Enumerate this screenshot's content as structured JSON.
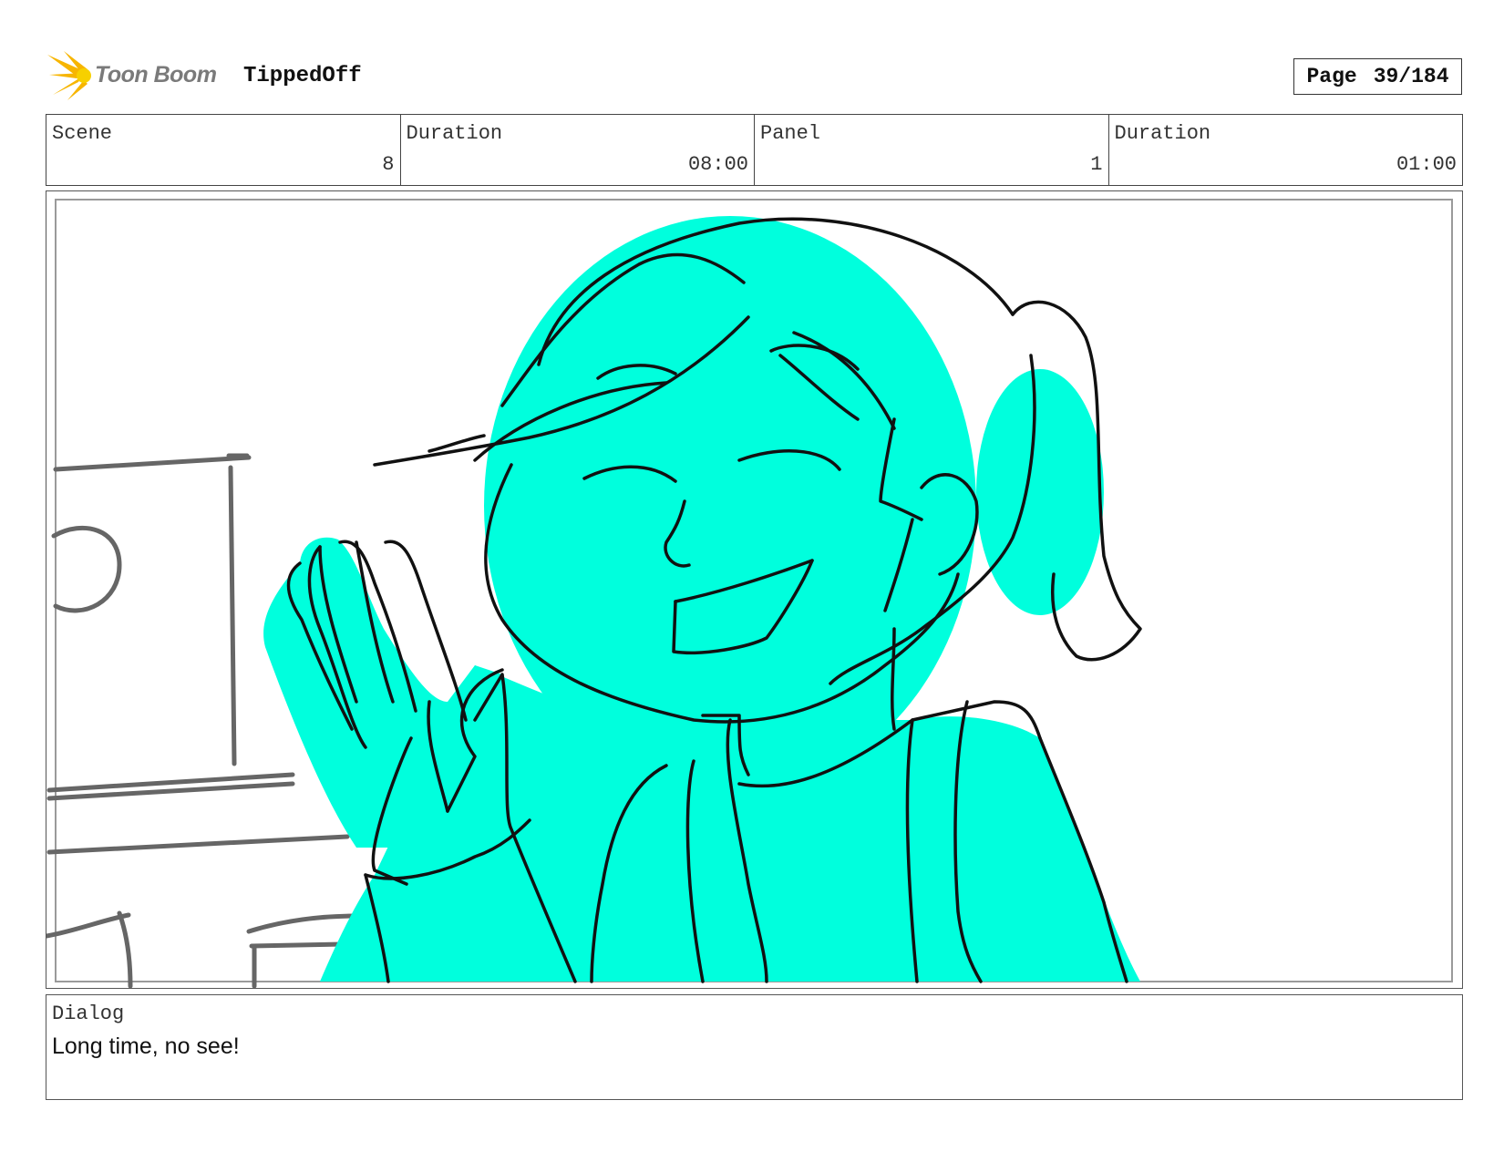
{
  "header": {
    "logo_text": "Toon Boom",
    "project_title": "TippedOff",
    "page_label": "Page",
    "page_value": "39/184"
  },
  "info": {
    "scene_label": "Scene",
    "scene_value": "8",
    "scene_duration_label": "Duration",
    "scene_duration_value": "08:00",
    "panel_label": "Panel",
    "panel_value": "1",
    "panel_duration_label": "Duration",
    "panel_duration_value": "01:00"
  },
  "panel": {
    "fill_color": "#00FFDD",
    "line_color": "#111111",
    "background_line_color": "#666666"
  },
  "dialog": {
    "label": "Dialog",
    "text": "Long time, no see!"
  }
}
